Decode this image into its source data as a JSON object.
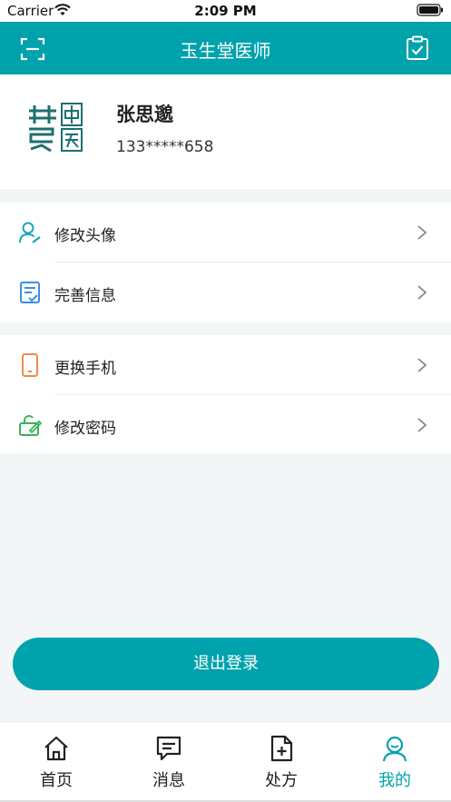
{
  "status_bar": {
    "carrier": "Carrier",
    "time": "2:09 PM"
  },
  "nav": {
    "title": "玉生堂医师",
    "left_icon": "scan-icon",
    "right_icon": "clipboard-check-icon"
  },
  "profile": {
    "name": "张思邈",
    "phone": "133*****658",
    "logo_text": "慧中医"
  },
  "menu_groups": [
    [
      {
        "label": "修改头像",
        "icon": "user-edit-icon",
        "color": "#1aa7b3"
      },
      {
        "label": "完善信息",
        "icon": "document-check-icon",
        "color": "#3a8ee6"
      }
    ],
    [
      {
        "label": "更换手机",
        "icon": "phone-icon",
        "color": "#f08a4b"
      },
      {
        "label": "修改密码",
        "icon": "lock-edit-icon",
        "color": "#3bb25a"
      }
    ]
  ],
  "logout_label": "退出登录",
  "tabs": [
    {
      "label": "首页",
      "icon": "home-icon",
      "active": false
    },
    {
      "label": "消息",
      "icon": "message-icon",
      "active": false
    },
    {
      "label": "处方",
      "icon": "prescription-icon",
      "active": false
    },
    {
      "label": "我的",
      "icon": "user-icon",
      "active": true
    }
  ],
  "colors": {
    "primary": "#00a2ac",
    "background": "#f3f6f7"
  }
}
